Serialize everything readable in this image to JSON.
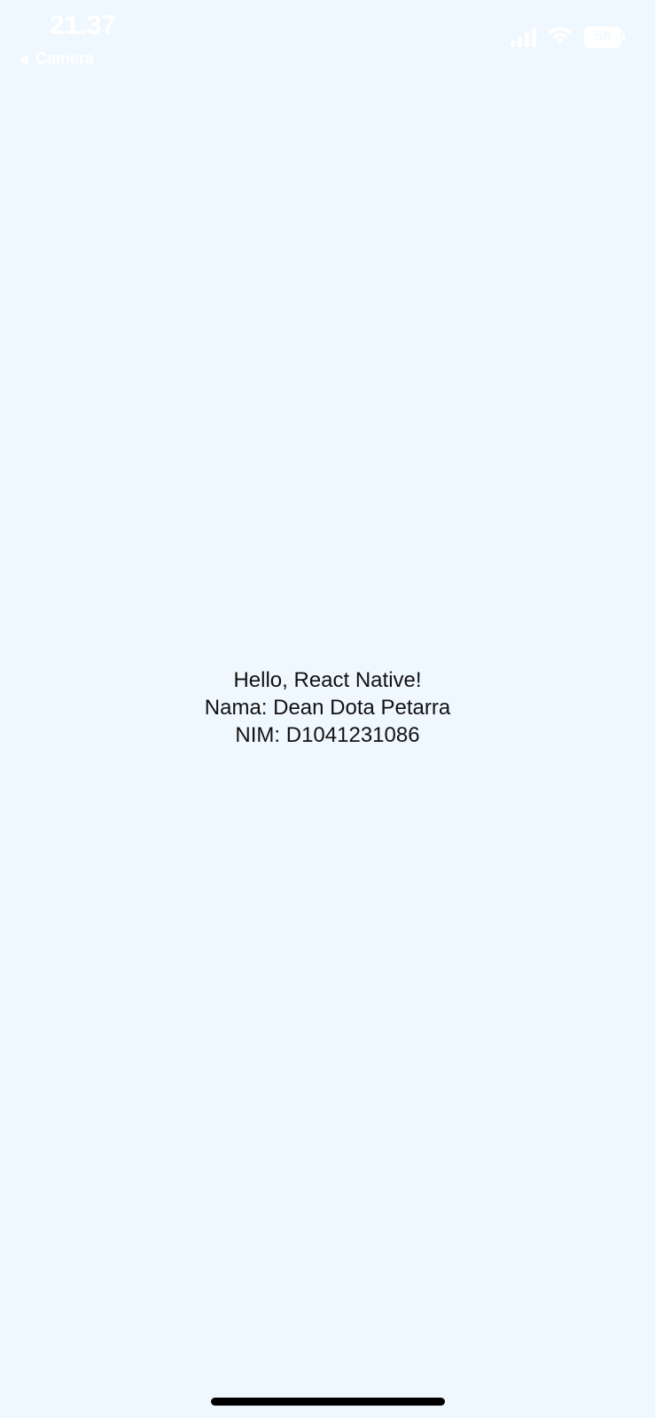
{
  "status_bar": {
    "time": "21.37",
    "back_app_label": "Camera",
    "battery_level": "56"
  },
  "main": {
    "greeting": "Hello, React Native!",
    "name_line": "Nama: Dean Dota Petarra",
    "nim_line": "NIM: D1041231086"
  },
  "icons": {
    "back": "back-arrow-icon",
    "signal": "cellular-signal-icon",
    "wifi": "wifi-icon",
    "battery": "battery-icon"
  },
  "colors": {
    "background": "#f0f8ff",
    "text": "#111111",
    "status_text": "#ffffff",
    "home_indicator": "#000000"
  }
}
